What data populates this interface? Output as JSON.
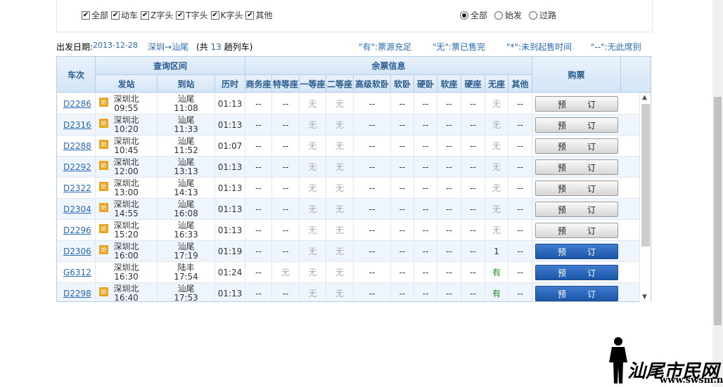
{
  "filters": {
    "checkboxes": [
      "全部",
      "动车",
      "Z字头",
      "T字头",
      "K字头",
      "其他"
    ],
    "radios": [
      "全部",
      "始发",
      "过路"
    ],
    "radio_selected": "全部"
  },
  "info": {
    "date_label": "出发日期:",
    "date": "2013-12-28",
    "route": "深圳→汕尾",
    "count_prefix": "(共",
    "count": "13",
    "count_suffix": "趟列车)",
    "legend": [
      "\"有\":票源充足",
      "\"无\":票已售完",
      "\"*\":未到起售时间",
      "\"--\":无此席别"
    ]
  },
  "header": {
    "train": "车次",
    "section": "查询区间",
    "depart": "发站",
    "arrive": "到站",
    "duration": "历时",
    "remaining": "余票信息",
    "buy": "购票",
    "seats": [
      "商务座",
      "特等座",
      "一等座",
      "二等座",
      "高级软卧",
      "软卧",
      "硬卧",
      "软座",
      "硬座",
      "无座",
      "其他"
    ]
  },
  "badge": "始",
  "button_label": "预订",
  "rows": [
    {
      "train": "D2286",
      "from": "深圳北",
      "dep": "09:55",
      "to": "汕尾",
      "arr": "11:08",
      "dur": "01:13",
      "badge": true,
      "seats": [
        "--",
        "--",
        "无",
        "无",
        "--",
        "--",
        "--",
        "--",
        "--",
        "无",
        "--"
      ],
      "bookable": false
    },
    {
      "train": "D2316",
      "from": "深圳北",
      "dep": "10:20",
      "to": "汕尾",
      "arr": "11:33",
      "dur": "01:13",
      "badge": true,
      "seats": [
        "--",
        "--",
        "无",
        "无",
        "--",
        "--",
        "--",
        "--",
        "--",
        "无",
        "--"
      ],
      "bookable": false
    },
    {
      "train": "D2288",
      "from": "深圳北",
      "dep": "10:45",
      "to": "汕尾",
      "arr": "11:52",
      "dur": "01:07",
      "badge": true,
      "seats": [
        "--",
        "--",
        "无",
        "无",
        "--",
        "--",
        "--",
        "--",
        "--",
        "无",
        "--"
      ],
      "bookable": false
    },
    {
      "train": "D2292",
      "from": "深圳北",
      "dep": "12:00",
      "to": "汕尾",
      "arr": "13:13",
      "dur": "01:13",
      "badge": true,
      "seats": [
        "--",
        "--",
        "无",
        "无",
        "--",
        "--",
        "--",
        "--",
        "--",
        "无",
        "--"
      ],
      "bookable": false
    },
    {
      "train": "D2322",
      "from": "深圳北",
      "dep": "13:00",
      "to": "汕尾",
      "arr": "14:13",
      "dur": "01:13",
      "badge": true,
      "seats": [
        "--",
        "--",
        "无",
        "无",
        "--",
        "--",
        "--",
        "--",
        "--",
        "无",
        "--"
      ],
      "bookable": false
    },
    {
      "train": "D2304",
      "from": "深圳北",
      "dep": "14:55",
      "to": "汕尾",
      "arr": "16:08",
      "dur": "01:13",
      "badge": true,
      "seats": [
        "--",
        "--",
        "无",
        "无",
        "--",
        "--",
        "--",
        "--",
        "--",
        "无",
        "--"
      ],
      "bookable": false
    },
    {
      "train": "D2296",
      "from": "深圳北",
      "dep": "15:20",
      "to": "汕尾",
      "arr": "16:33",
      "dur": "01:13",
      "badge": true,
      "seats": [
        "--",
        "--",
        "无",
        "无",
        "--",
        "--",
        "--",
        "--",
        "--",
        "无",
        "--"
      ],
      "bookable": false
    },
    {
      "train": "D2306",
      "from": "深圳北",
      "dep": "16:00",
      "to": "汕尾",
      "arr": "17:19",
      "dur": "01:19",
      "badge": true,
      "seats": [
        "--",
        "--",
        "无",
        "无",
        "--",
        "--",
        "--",
        "--",
        "--",
        "1",
        "--"
      ],
      "bookable": true
    },
    {
      "train": "G6312",
      "from": "深圳北",
      "dep": "16:30",
      "to": "陆丰",
      "arr": "17:54",
      "dur": "01:24",
      "badge": false,
      "seats": [
        "--",
        "无",
        "无",
        "无",
        "--",
        "--",
        "--",
        "--",
        "--",
        "有",
        "--"
      ],
      "bookable": true
    },
    {
      "train": "D2298",
      "from": "深圳北",
      "dep": "16:40",
      "to": "汕尾",
      "arr": "17:53",
      "dur": "01:13",
      "badge": true,
      "seats": [
        "--",
        "--",
        "无",
        "无",
        "--",
        "--",
        "--",
        "--",
        "--",
        "有",
        "--"
      ],
      "bookable": true
    }
  ],
  "watermark": {
    "text": "汕尾市民网",
    "url": "www.swsm.net"
  },
  "colors": {
    "link": "#2a6bb5",
    "header_bg": "#d4e5f6",
    "available": "#1e8c1e",
    "button_active": "#1c56a8"
  }
}
